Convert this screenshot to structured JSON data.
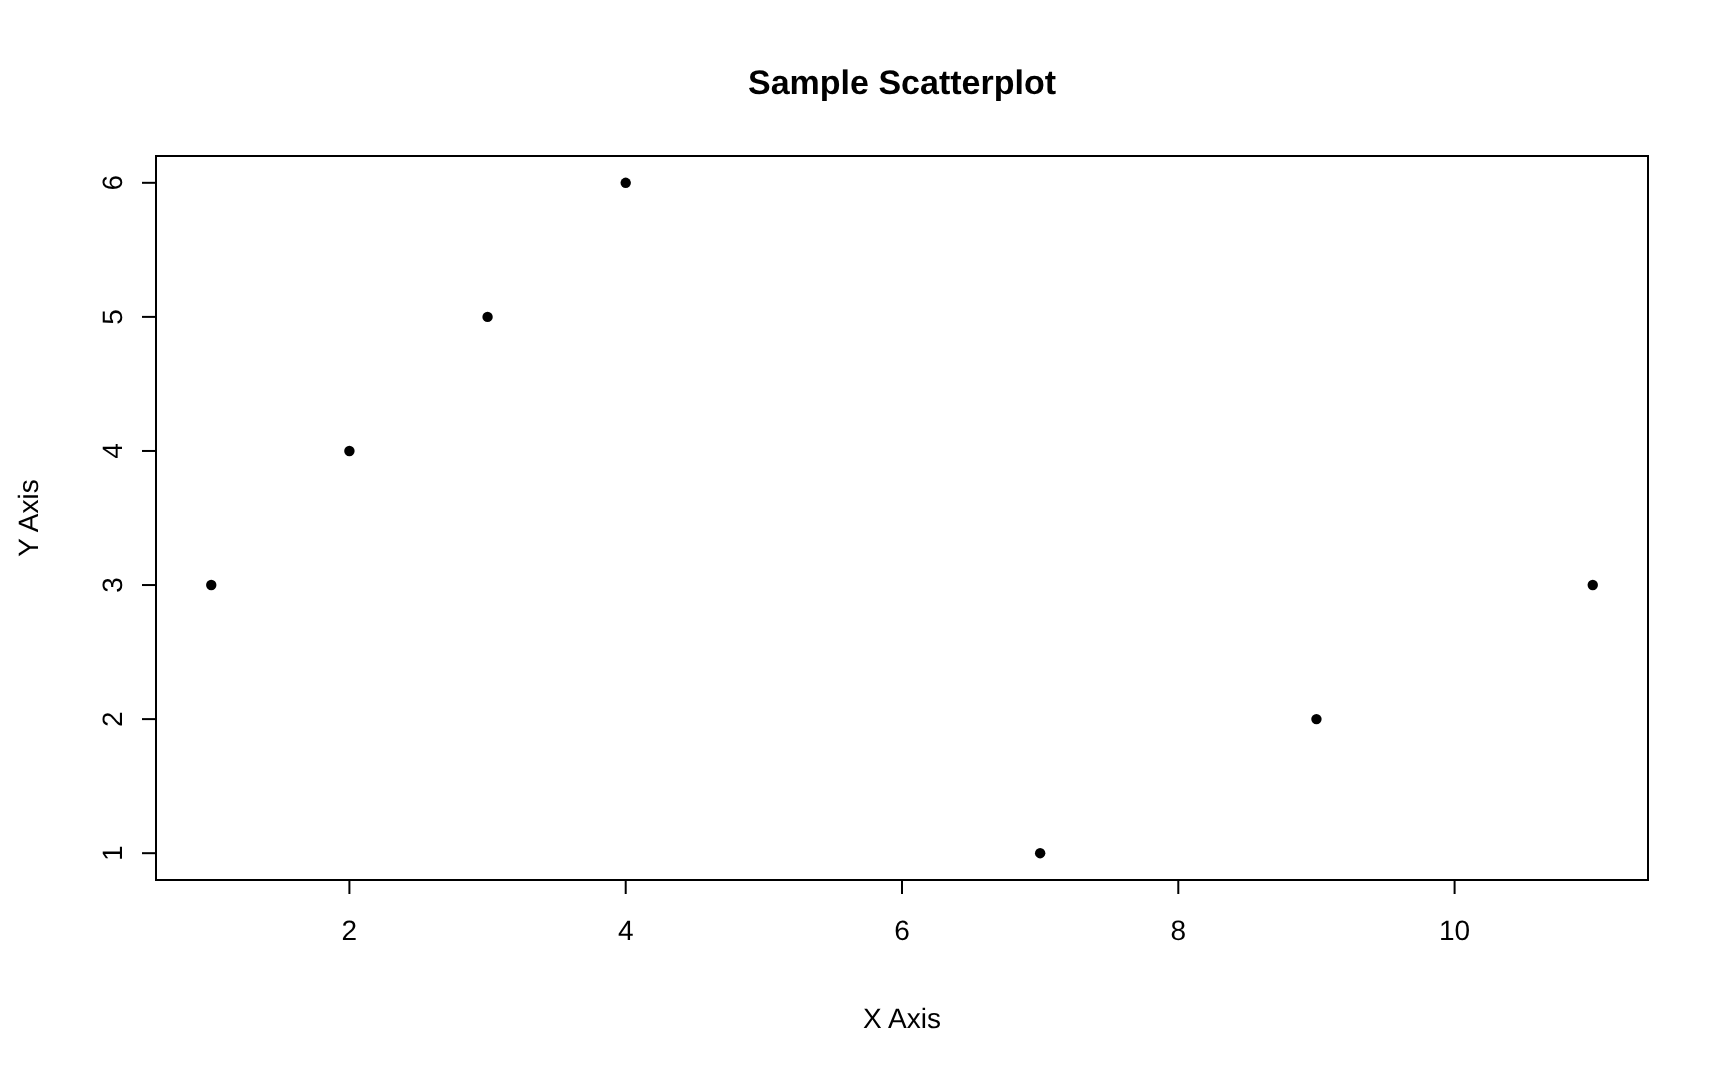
{
  "chart_data": {
    "type": "scatter",
    "title": "Sample Scatterplot",
    "xlabel": "X Axis",
    "ylabel": "Y Axis",
    "x": [
      1,
      2,
      3,
      4,
      7,
      9,
      11
    ],
    "series": [
      {
        "color": "#000000",
        "values": [
          3,
          4,
          5,
          6,
          1,
          2,
          3
        ]
      }
    ],
    "xlim": [
      0.6,
      11.4
    ],
    "ylim": [
      0.8,
      6.2
    ],
    "xticks": [
      2,
      4,
      6,
      8,
      10
    ],
    "yticks": [
      1,
      2,
      3,
      4,
      5,
      6
    ]
  }
}
